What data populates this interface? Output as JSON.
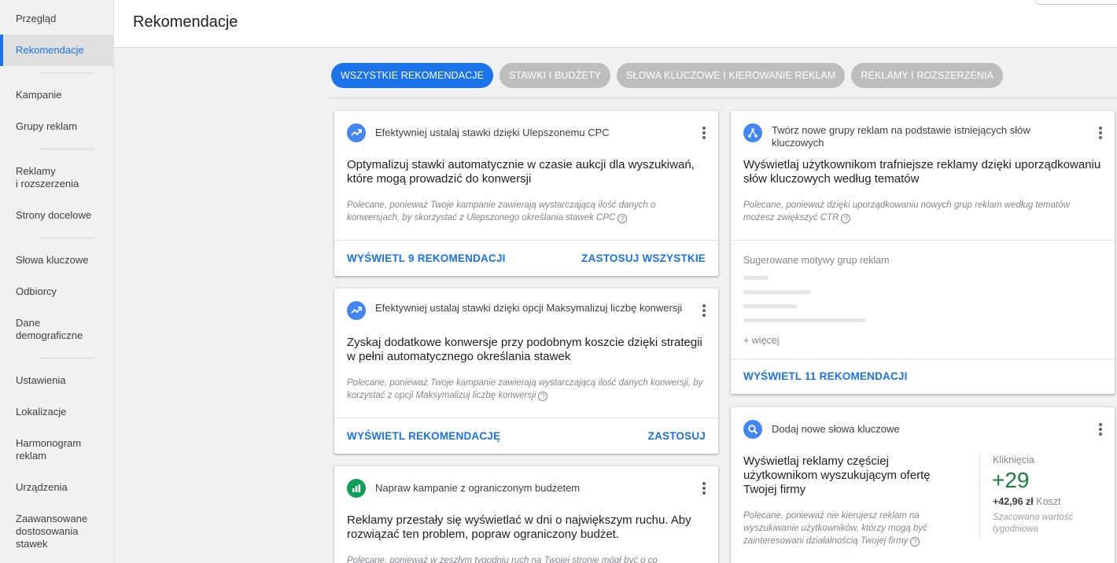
{
  "sidebar": {
    "items": [
      {
        "id": "przeglad",
        "label": "Przegląd"
      },
      {
        "id": "rekomendacje",
        "label": "Rekomendacje"
      },
      {
        "id": "kampanie",
        "label": "Kampanie"
      },
      {
        "id": "grupy",
        "label": "Grupy reklam"
      },
      {
        "id": "reklamy",
        "label": "Reklamy\ni rozszerzenia"
      },
      {
        "id": "strony",
        "label": "Strony docelowe"
      },
      {
        "id": "slowa",
        "label": "Słowa kluczowe"
      },
      {
        "id": "odbiorcy",
        "label": "Odbiorcy"
      },
      {
        "id": "dane",
        "label": "Dane\ndemograficzne"
      },
      {
        "id": "ustawienia",
        "label": "Ustawienia"
      },
      {
        "id": "lokalizacje",
        "label": "Lokalizacje"
      },
      {
        "id": "harmonogram",
        "label": "Harmonogram\nreklam"
      },
      {
        "id": "urzadzenia",
        "label": "Urządzenia"
      },
      {
        "id": "zaawansowane",
        "label": "Zaawansowane\ndostosowania\nstawek"
      }
    ],
    "active": "rekomendacje"
  },
  "header": {
    "title": "Rekomendacje"
  },
  "chips": [
    {
      "label": "WSZYSTKIE REKOMENDACJE",
      "active": true
    },
    {
      "label": "STAWKI I BUDŻETY",
      "active": false
    },
    {
      "label": "SŁOWA KLUCZOWE I KIEROWANIE REKLAM",
      "active": false
    },
    {
      "label": "REKLAMY I ROZSZERZENIA",
      "active": false
    }
  ],
  "cards": {
    "cpc": {
      "head": "Efektywniej ustalaj stawki dzięki Ulepszonemu CPC",
      "title": "Optymalizuj stawki automatycznie w czasie aukcji dla wyszukiwań, które mogą prowadzić do konwersji",
      "desc": "Polecane, ponieważ Twoje kampanie zawierają wystarczającą ilość danych o konwersjach, by skorzystać z Ulepszonego określania stawek CPC",
      "action_left": "WYŚWIETL 9 REKOMENDACJI",
      "action_right": "ZASTOSUJ WSZYSTKIE"
    },
    "maxconv": {
      "head": "Efektywniej ustalaj stawki dzięki opcji Maksymalizuj liczbę konwersji",
      "title": "Zyskaj dodatkowe konwersje przy podobnym koszcie dzięki strategii w pełni automatycznego określania stawek",
      "desc": "Polecane, ponieważ Twoje kampanie zawierają wystarczającą ilość danych konwersji, by korzystać z opcji Maksymalizuj liczbę konwersji",
      "action_left": "WYŚWIETL REKOMENDACJĘ",
      "action_right": "ZASTOSUJ"
    },
    "budget": {
      "head": "Napraw kampanie z ograniczonym budżetem",
      "title": "Reklamy przestały się wyświetlać w dni o największym ruchu. Aby rozwiązać ten problem, popraw ograniczony budżet.",
      "desc": "Polecane, ponieważ w zeszłym tygodniu ruch na Twojej stronie mógł być o co"
    },
    "adgroups": {
      "head": "Twórz nowe grupy reklam na podstawie istniejących słów kluczowych",
      "title": "Wyświetlaj użytkownikom trafniejsze reklamy dzięki uporządkowaniu słów kluczowych według tematów",
      "desc": "Polecane, ponieważ dzięki uporządkowaniu nowych grup reklam według tematów możesz zwiększyć CTR",
      "suggest_label": "Sugerowane motywy grup reklam",
      "more": "+ więcej",
      "action_left": "WYŚWIETL 11 REKOMENDACJI"
    },
    "keywords": {
      "head": "Dodaj nowe słowa kluczowe",
      "title": "Wyświetlaj reklamy częściej użytkownikom wyszukującym ofertę Twojej firmy",
      "desc": "Polecane, ponieważ nie kierujesz reklam na wyszukiwanie użytkowników, którzy mogą być zainteresowani działalnością Twojej firmy",
      "metric_label": "Kliknięcia",
      "metric_value": "+29",
      "metric_cost_value": "+42,96 zł",
      "metric_cost_label": "Koszt",
      "metric_note": "Szacowana wartość tygodniowa"
    }
  },
  "colors": {
    "accent": "#1a73e8",
    "positive": "#188038",
    "chip_inactive": "#bdbdbd"
  }
}
